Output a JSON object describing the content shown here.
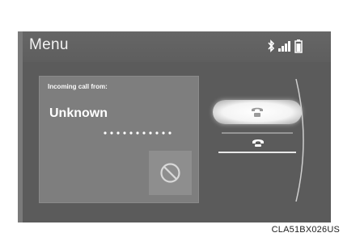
{
  "header": {
    "title": "Menu",
    "status_icons": [
      "bluetooth-icon",
      "signal-strength-icon",
      "battery-icon"
    ]
  },
  "call_popup": {
    "incoming_label": "Incoming call from:",
    "caller_name": "Unknown",
    "status_dots": "•••••••••••",
    "mute_icon": "prohibited-icon"
  },
  "actions": {
    "accept_icon": "phone-handset-icon",
    "decline_icon": "phone-hangup-icon"
  },
  "caption": "CLA51BX026US",
  "colors": {
    "screen_bg": "#5b5b5b",
    "popup_bg": "#7e7e7e",
    "text": "#ffffff",
    "accept_button": "#f4f4f4"
  }
}
